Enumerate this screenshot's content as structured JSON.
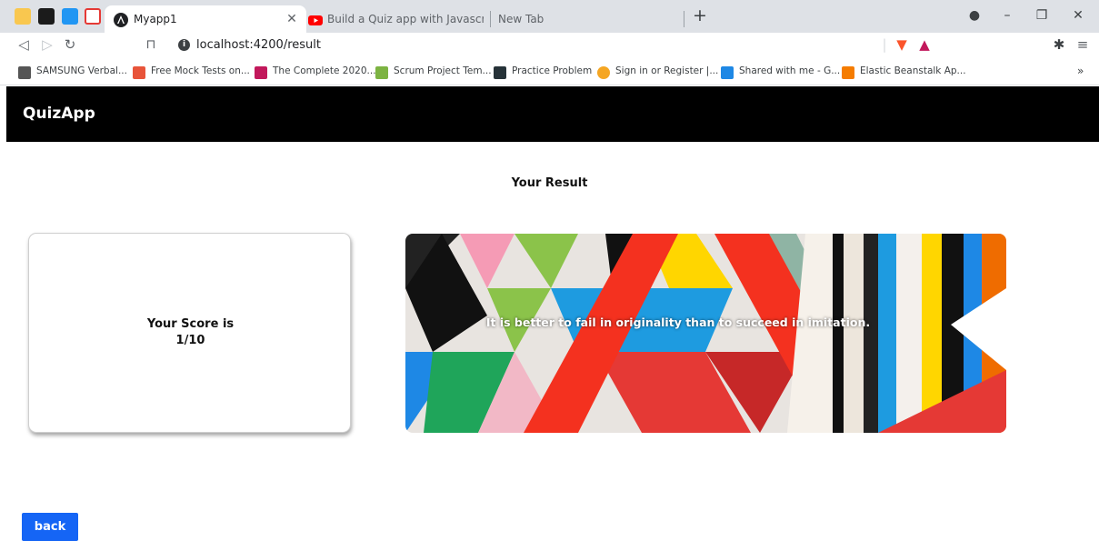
{
  "browser": {
    "tabs": [
      {
        "title": "Myapp1",
        "active": true,
        "icon": "angular-icon"
      },
      {
        "title": "Build a Quiz app with Javascript/Angu",
        "active": false,
        "icon": "youtube-icon"
      },
      {
        "title": "New Tab",
        "active": false,
        "icon": ""
      }
    ],
    "new_tab_label": "+",
    "url": "localhost:4200/result",
    "bookmarks": [
      {
        "label": "SAMSUNG Verbal...",
        "color": "#555555"
      },
      {
        "label": "Free Mock Tests on...",
        "color": "#e8543a"
      },
      {
        "label": "The Complete 2020...",
        "color": "#c2185b"
      },
      {
        "label": "Scrum Project Tem...",
        "color": "#7cb342"
      },
      {
        "label": "Practice Problem",
        "color": "#263238"
      },
      {
        "label": "Sign in or Register |...",
        "color": "#f5a623"
      },
      {
        "label": "Shared with me - G...",
        "color": "#1e88e5"
      },
      {
        "label": "Elastic Beanstalk Ap...",
        "color": "#f57c00"
      }
    ],
    "more_bookmarks": "»"
  },
  "app": {
    "brand": "QuizApp",
    "result_heading": "Your Result",
    "score_label": "Your Score is",
    "score_value": "1/10",
    "quote": "It is better to fail in originality than to succeed in imitation.",
    "back_label": "back"
  },
  "colors": {
    "header_bg": "#000000",
    "button_bg": "#1565f5",
    "tabstrip_bg": "#dee1e6"
  }
}
